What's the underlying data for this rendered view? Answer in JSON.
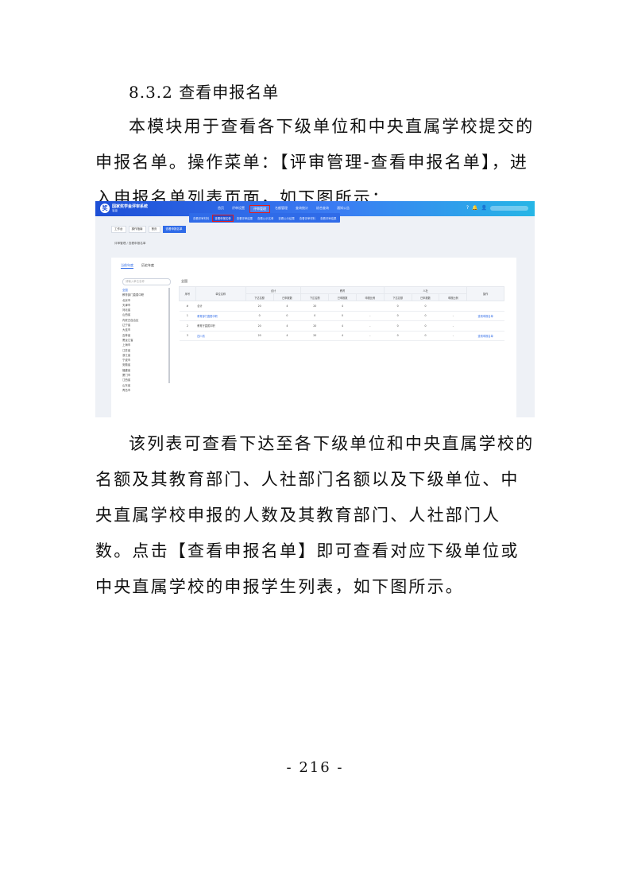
{
  "doc": {
    "heading": "8.3.2 查看申报名单",
    "para1": "本模块用于查看各下级单位和中央直属学校提交的申报名单。操作菜单：【评审管理-查看申报名单】，进入申报名单列表页面，如下图所示：",
    "para2": "该列表可查看下达至各下级单位和中央直属学校的名额及其教育部门、人社部门名额以及下级单位、中央直属学校申报的人数及其教育部门、人社部门人数。点击【查看申报名单】即可查看对应下级单位或中央直属学校的申报学生列表，如下图所示。",
    "page_number": "- 216 -"
  },
  "screenshot": {
    "system_name": "国家奖学金评审系统",
    "system_sub": "省级",
    "logo_glyph": "奖",
    "top_nav": [
      "首页",
      "评审设置",
      "评审管理",
      "名额管理",
      "查询统计",
      "综合查询",
      "通知公告"
    ],
    "top_icons": [
      "?",
      "🔔",
      "👤"
    ],
    "sub_nav": [
      "查看评审材料",
      "查看申报名单",
      "查看评审结果",
      "查看公示名单",
      "查看公示结果",
      "查看评审材料",
      "查看评审结果"
    ],
    "tabs": [
      "工作台",
      "操作指南",
      "首页",
      "查看申报名单"
    ],
    "breadcrumb": "评审管理 / 查看申报名单",
    "card_tabs": [
      "当前年度",
      "历史年度"
    ],
    "search_placeholder": "请输入单位名称",
    "tree": [
      "全国",
      "教育部门直属中职",
      "北京市",
      "天津市",
      "河北省",
      "山西省",
      "内蒙古自治区",
      "辽宁省",
      "大连市",
      "吉林省",
      "黑龙江省",
      "上海市",
      "江苏省",
      "浙江省",
      "宁波市",
      "安徽省",
      "福建省",
      "厦门市",
      "江西省",
      "山东省",
      "青岛市"
    ],
    "table_title": "全国",
    "group_headers": [
      "合计",
      "教育",
      "人社"
    ],
    "col_headers": [
      "序号",
      "单位名称",
      "下达名额",
      "已申报数",
      "下达名额",
      "已申报数",
      "申报比例",
      "下达名额",
      "已申报数",
      "申报比例",
      "操作"
    ],
    "rows": [
      {
        "no": "#",
        "name": "合计",
        "c1": "20",
        "c2": "4",
        "c3": "20",
        "c4": "4",
        "c5": "",
        "c6": "0",
        "c7": "0",
        "c8": "",
        "op": ""
      },
      {
        "no": "1",
        "name": "教育部门直属中职",
        "c1": "0",
        "c2": "0",
        "c3": "0",
        "c4": "0",
        "c5": "-",
        "c6": "0",
        "c7": "0",
        "c8": "-",
        "op": "查看申报名单"
      },
      {
        "no": "2",
        "name": "教育厅直属中职",
        "c1": "20",
        "c2": "4",
        "c3": "20",
        "c4": "4",
        "c5": "-",
        "c6": "0",
        "c7": "0",
        "c8": "-",
        "op": ""
      },
      {
        "no": "3",
        "name": "四川省",
        "c1": "20",
        "c2": "4",
        "c3": "20",
        "c4": "4",
        "c5": "-",
        "c6": "0",
        "c7": "0",
        "c8": "-",
        "op": "查看申报名单"
      }
    ]
  }
}
